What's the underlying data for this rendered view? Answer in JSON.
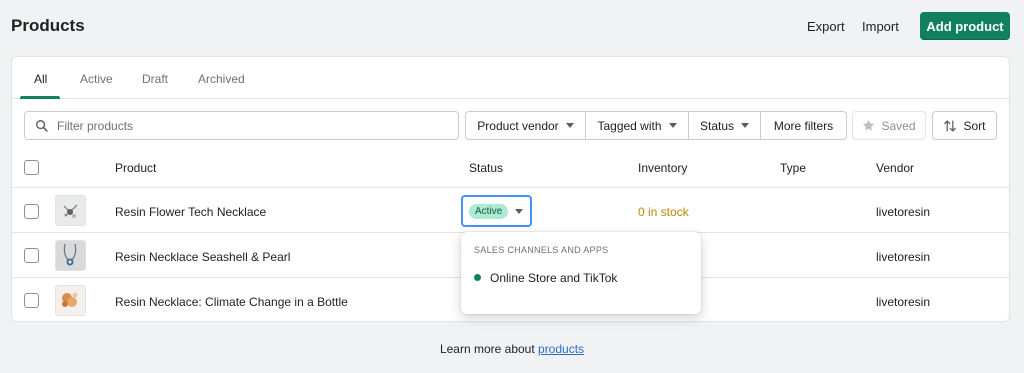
{
  "header": {
    "title": "Products",
    "export_label": "Export",
    "import_label": "Import",
    "add_label": "Add product"
  },
  "tabs": [
    {
      "label": "All",
      "active": true
    },
    {
      "label": "Active",
      "active": false
    },
    {
      "label": "Draft",
      "active": false
    },
    {
      "label": "Archived",
      "active": false
    }
  ],
  "filters": {
    "search_placeholder": "Filter products",
    "buttons": [
      "Product vendor",
      "Tagged with",
      "Status",
      "More filters"
    ],
    "saved_label": "Saved",
    "sort_label": "Sort"
  },
  "table": {
    "columns": [
      "Product",
      "Status",
      "Inventory",
      "Type",
      "Vendor"
    ],
    "rows": [
      {
        "product": "Resin Flower Tech Necklace",
        "status": "Active",
        "inventory": "0 in stock",
        "type": "",
        "vendor": "livetoresin"
      },
      {
        "product": "Resin Necklace Seashell & Pearl",
        "status": "",
        "inventory": "",
        "type": "",
        "vendor": "livetoresin"
      },
      {
        "product": "Resin Necklace: Climate Change in a Bottle",
        "status": "",
        "inventory": "",
        "type": "",
        "vendor": "livetoresin"
      }
    ]
  },
  "popover": {
    "heading": "SALES CHANNELS AND APPS",
    "items": [
      "Online Store and TikTok"
    ]
  },
  "footer": {
    "text": "Learn more about ",
    "link": "products"
  },
  "colors": {
    "primary": "#108060",
    "active_badge_bg": "#aee9d1",
    "out_of_stock": "#b98900",
    "link": "#2c6ecb",
    "focus_ring": "#458fff"
  }
}
